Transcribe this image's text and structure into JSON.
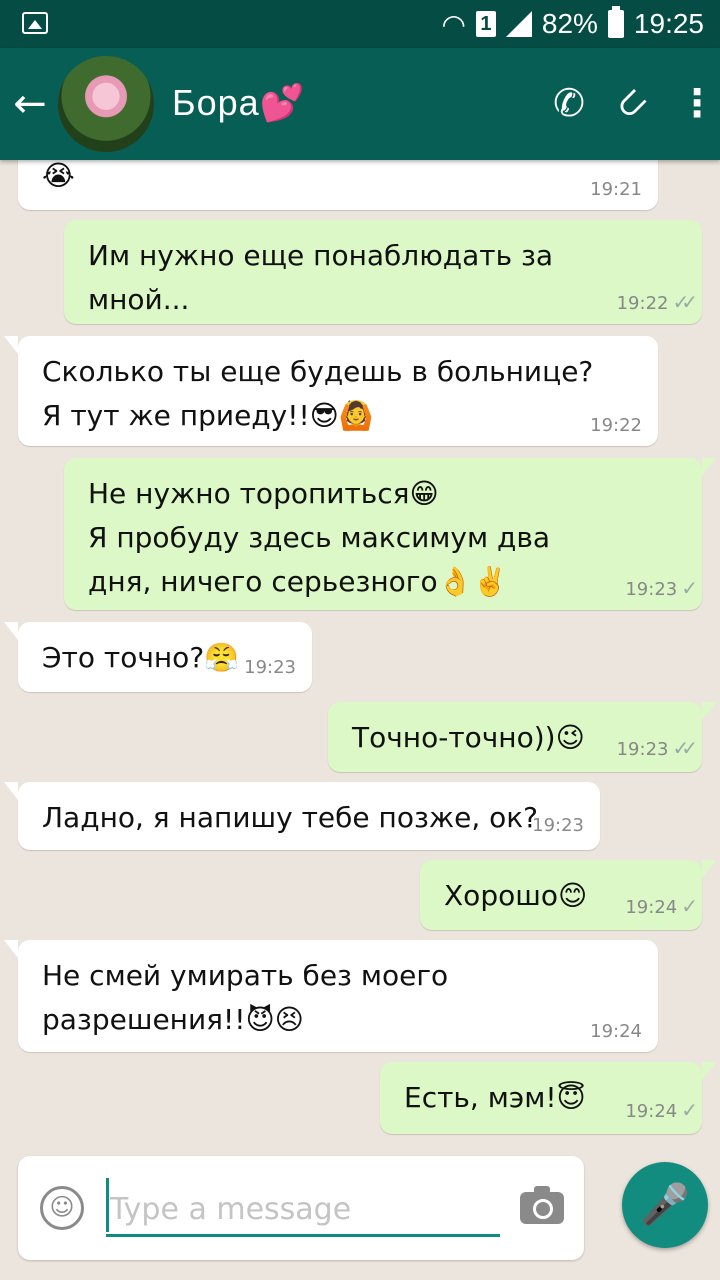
{
  "status_bar": {
    "sim": "1",
    "battery": "82%",
    "time": "19:25"
  },
  "header": {
    "contact_name": "Бора💕",
    "back_icon": "back-arrow-icon",
    "call_icon": "phone-icon",
    "attach_icon": "paperclip-icon",
    "menu_icon": "more-vert-icon"
  },
  "messages": [
    {
      "dir": "in",
      "lines": [
        "😭"
      ],
      "time": "19:21",
      "tick": ""
    },
    {
      "dir": "out",
      "lines": [
        "Им нужно еще понаблюдать за",
        "мной..."
      ],
      "time": "19:22",
      "tick": "✓✓"
    },
    {
      "dir": "in",
      "lines": [
        "Сколько ты еще будешь в больнице?",
        "Я тут же приеду!!😎🙆"
      ],
      "time": "19:22",
      "tick": ""
    },
    {
      "dir": "out",
      "lines": [
        "Не нужно торопиться😁",
        "Я пробуду здесь максимум два",
        "дня, ничего серьезного👌✌️"
      ],
      "time": "19:23",
      "tick": "✓"
    },
    {
      "dir": "in",
      "lines": [
        "Это точно?😤"
      ],
      "time": "19:23",
      "tick": ""
    },
    {
      "dir": "out",
      "lines": [
        "Точно-точно))😉"
      ],
      "time": "19:23",
      "tick": "✓✓"
    },
    {
      "dir": "in",
      "lines": [
        "Ладно, я напишу тебе позже, ок?"
      ],
      "time": "19:23",
      "tick": ""
    },
    {
      "dir": "out",
      "lines": [
        "Хорошо😊"
      ],
      "time": "19:24",
      "tick": "✓"
    },
    {
      "dir": "in",
      "lines": [
        "Не смей умирать без моего",
        "разрешения!!😈😣"
      ],
      "time": "19:24",
      "tick": ""
    },
    {
      "dir": "out",
      "lines": [
        "Есть, мэм!😇"
      ],
      "time": "19:24",
      "tick": "✓"
    }
  ],
  "composer": {
    "placeholder": "Type a message",
    "emoji_icon": "emoji-icon",
    "camera_icon": "camera-icon",
    "mic_icon": "mic-icon"
  },
  "colors": {
    "status_bar": "#054d44",
    "app_bar": "#075e54",
    "outgoing_bubble": "#dcf8c6",
    "incoming_bubble": "#ffffff",
    "accent": "#128c7e",
    "chat_background": "#ece5dd"
  }
}
